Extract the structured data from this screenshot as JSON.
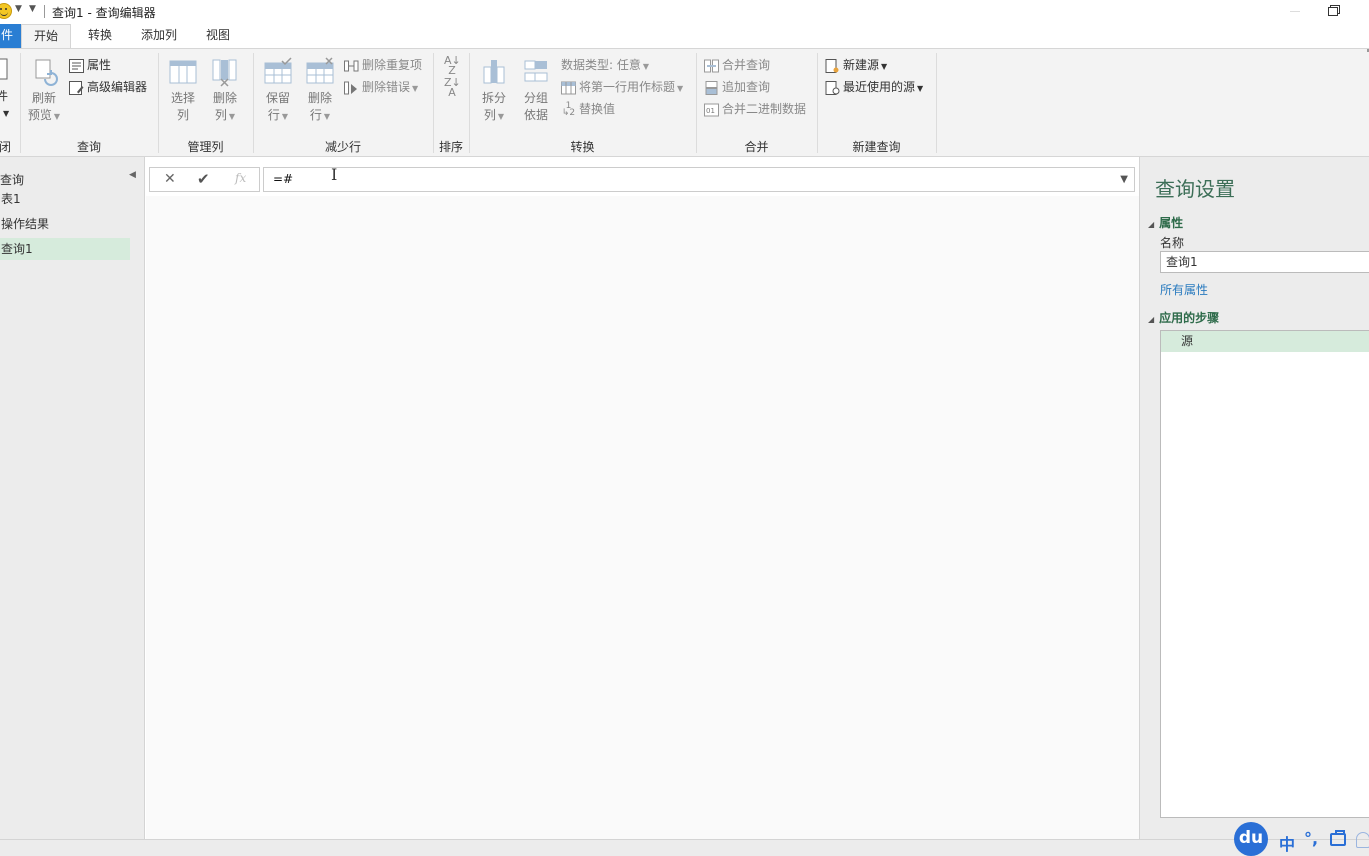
{
  "titlebar": {
    "title": "查询1 - 查询编辑器"
  },
  "tabs": [
    {
      "label": "件"
    },
    {
      "label": "开始"
    },
    {
      "label": "转换"
    },
    {
      "label": "添加列"
    },
    {
      "label": "视图"
    }
  ],
  "ribbon": {
    "groups": {
      "close": "闭",
      "query": "查询",
      "manage_columns": "管理列",
      "reduce_rows": "减少行",
      "sort": "排序",
      "transform": "转换",
      "combine": "合并",
      "new_query": "新建查询"
    },
    "buttons": {
      "file_partial": "件",
      "refresh_preview": [
        "刷新",
        "预览"
      ],
      "properties": "属性",
      "advanced_editor": "高级编辑器",
      "choose_columns": [
        "选择",
        "列"
      ],
      "remove_columns": [
        "删除",
        "列"
      ],
      "keep_rows": [
        "保留",
        "行"
      ],
      "remove_rows": [
        "删除",
        "行"
      ],
      "remove_duplicates": "删除重复项",
      "remove_errors": "删除错误",
      "split_column": [
        "拆分",
        "列"
      ],
      "group_by": [
        "分组",
        "依据"
      ],
      "data_type": "数据类型: 任意",
      "use_first_row": "将第一行用作标题",
      "replace_values": "替换值",
      "merge_queries": "合并查询",
      "append_queries": "追加查询",
      "combine_binaries": "合并二进制数据",
      "new_source": "新建源",
      "recent_sources": "最近使用的源"
    }
  },
  "navigator": {
    "header": "查询",
    "items": [
      {
        "label": "表1",
        "selected": false
      },
      {
        "label": "操作结果",
        "selected": false
      },
      {
        "label": "查询1",
        "selected": true
      }
    ]
  },
  "formula_bar": {
    "value": "=#",
    "fx_label": "fx"
  },
  "settings": {
    "title": "查询设置",
    "properties_section": "属性",
    "name_label": "名称",
    "name_value": "查询1",
    "all_properties_link": "所有属性",
    "steps_section": "应用的步骤",
    "steps": [
      {
        "label": "源"
      }
    ]
  },
  "ime": {
    "du_label": "du",
    "lang": "中",
    "punct": "°,"
  },
  "colors": {
    "accent": "#2a7ed3",
    "selection": "#d6ebdc",
    "title_green": "#3c6e57"
  }
}
